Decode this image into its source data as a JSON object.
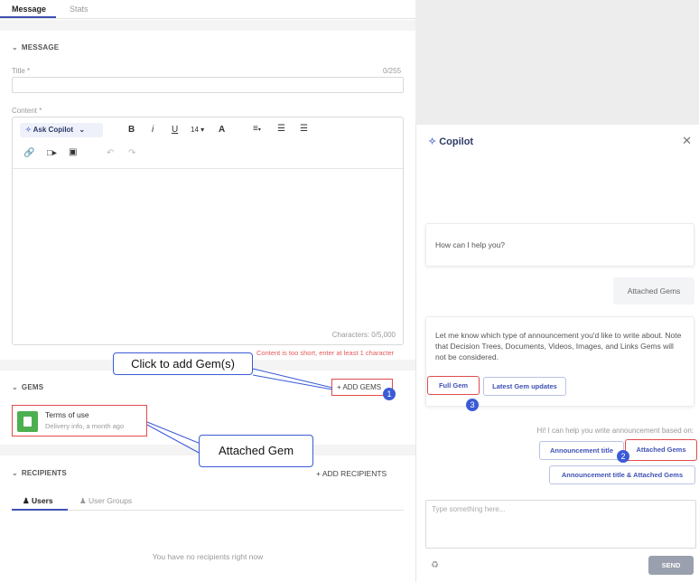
{
  "tabs": [
    {
      "label": "Message",
      "active": true
    },
    {
      "label": "Stats",
      "active": false
    }
  ],
  "message": {
    "section_title": "MESSAGE",
    "title_label": "Title *",
    "title_counter": "0/255",
    "title_value": "",
    "content_label": "Content *",
    "toolbar": {
      "ask_copilot": "Ask Copilot",
      "bold": "B",
      "italic": "i",
      "underline": "U",
      "font_size": "14",
      "text_color": "A"
    },
    "characters": "Characters: 0/5,000",
    "error": "Content is too short, enter at least 1 character"
  },
  "gems": {
    "section_title": "GEMS",
    "add_label": "ADD GEMS",
    "item": {
      "title": "Terms of use",
      "subtitle": "Delivery info, a month ago"
    }
  },
  "recipients": {
    "section_title": "RECIPIENTS",
    "add_label": "ADD RECIPIENTS",
    "tabs": [
      {
        "label": "Users",
        "active": true
      },
      {
        "label": "User Groups",
        "active": false
      }
    ],
    "empty": "You have no recipients right now"
  },
  "callouts": {
    "click_add": "Click to add Gem(s)",
    "attached": "Attached Gem",
    "badge1": "1",
    "badge2": "2",
    "badge3": "3"
  },
  "copilot": {
    "title": "Copilot",
    "greeting": "How can I help you?",
    "user_reply": "Attached Gems",
    "prompt": "Let me know which type of announcement you'd like to write about. Note that Decision Trees, Documents, Videos, Images, and Links Gems will not be considered.",
    "option_full": "Full Gem",
    "option_latest": "Latest Gem updates",
    "hint": "Hi! I can help you write announcement based on:",
    "option_ann_title": "Announcement title",
    "option_attached": "Attached Gems",
    "option_both": "Announcement title & Attached Gems",
    "input_placeholder": "Type something here...",
    "send": "SEND"
  },
  "colors": {
    "accent": "#3f51b5",
    "highlight": "#e24b4b",
    "gem_icon": "#4caf50",
    "callout": "#3b5bd6"
  }
}
